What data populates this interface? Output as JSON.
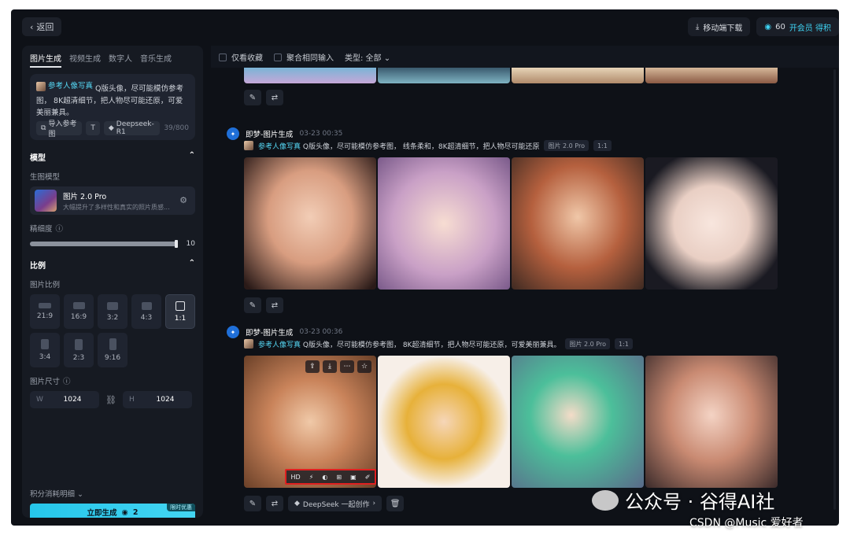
{
  "topbar": {
    "back_label": "返回",
    "mobile_download": "移动端下载",
    "credits": "60",
    "membership": "开会员 得积"
  },
  "left": {
    "tabs": [
      {
        "label": "图片生成",
        "active": true
      },
      {
        "label": "视频生成",
        "active": false
      },
      {
        "label": "数字人",
        "active": false
      },
      {
        "label": "音乐生成",
        "active": false
      }
    ],
    "prompt": {
      "ref_chip": "参考人像写真",
      "text": "Q版头像，尽可能模仿参考图， 8K超清细节，把人物尽可能还原，可爱美丽兼具。",
      "import_ref": "导入参考图",
      "deepseek": "Deepseek-R1",
      "counter": "39/800"
    },
    "model_section": "模型",
    "gen_model_label": "生图模型",
    "model": {
      "name": "图片 2.0 Pro",
      "desc": "大幅提升了多样性和真实的照片质感..."
    },
    "detail_label": "精细度",
    "detail_value": "10",
    "detail_fraction": 1.0,
    "ratio_section": "比例",
    "ratio_label": "图片比例",
    "ratios": [
      {
        "label": "21:9",
        "active": false
      },
      {
        "label": "16:9",
        "active": false
      },
      {
        "label": "3:2",
        "active": false
      },
      {
        "label": "4:3",
        "active": false
      },
      {
        "label": "1:1",
        "active": true
      },
      {
        "label": "3:4",
        "active": false
      },
      {
        "label": "2:3",
        "active": false
      },
      {
        "label": "9:16",
        "active": false
      }
    ],
    "size_label": "图片尺寸",
    "width_label": "W",
    "width": "1024",
    "height_label": "H",
    "height": "1024",
    "credits_detail": "积分消耗明细",
    "generate": "立即生成",
    "generate_cost": "2",
    "promo": "限时优惠"
  },
  "main": {
    "filter": {
      "favorites": "仅看收藏",
      "merge": "聚合相同输入",
      "type": "类型: 全部"
    },
    "results": [
      {
        "title": "即梦-图片生成",
        "time": "03-23  00:35",
        "ref_chip": "参考人像写真",
        "prompt": "Q版头像，尽可能模仿参考图， 线条柔和，8K超清细节，把人物尽可能还原",
        "model_tag": "图片 2.0 Pro",
        "ratio_tag": "1:1"
      },
      {
        "title": "即梦-图片生成",
        "time": "03-23  00:36",
        "ref_chip": "参考人像写真",
        "prompt": "Q版头像，尽可能模仿参考图， 8K超清细节，把人物尽可能还原，可爱美丽兼具。",
        "model_tag": "图片 2.0 Pro",
        "ratio_tag": "1:1",
        "deepseek_action": "DeepSeek 一起创作",
        "hd_label": "HD"
      }
    ]
  },
  "watermark": {
    "line1": "公众号 · 谷得AI社",
    "line2": "CSDN @Music 爱好者"
  }
}
